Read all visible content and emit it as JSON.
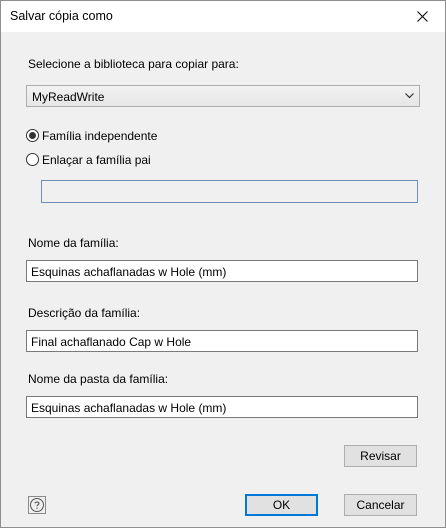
{
  "window": {
    "title": "Salvar cópia como",
    "close_icon": "close-icon"
  },
  "library": {
    "label": "Selecione a biblioteca para copiar para:",
    "selected": "MyReadWrite",
    "dropdown_icon": "chevron-down-icon"
  },
  "family_options": {
    "independent_label": "Família independente",
    "link_parent_label": "Enlaçar a família pai",
    "selected": "independent",
    "parent_value": ""
  },
  "family_name": {
    "label": "Nome da família:",
    "value": "Esquinas achaflanadas w Hole (mm)"
  },
  "family_description": {
    "label": "Descrição da família:",
    "value": "Final achaflanado Cap w Hole"
  },
  "folder_name": {
    "label": "Nome da pasta da família:",
    "value": "Esquinas achaflanadas w Hole (mm)"
  },
  "buttons": {
    "review": "Revisar",
    "ok": "OK",
    "cancel": "Cancelar",
    "help_icon": "help-icon"
  },
  "colors": {
    "accent": "#0078d7",
    "background": "#f0f0f0"
  }
}
